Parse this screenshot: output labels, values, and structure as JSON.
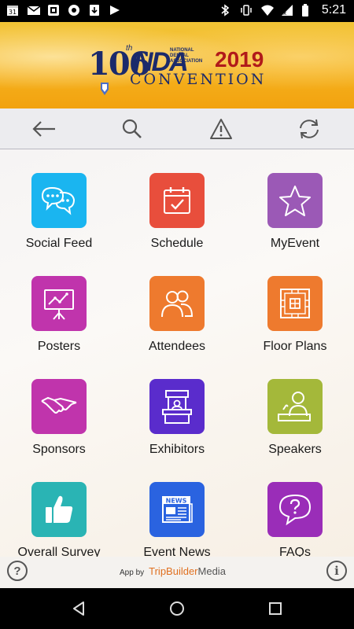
{
  "status_bar": {
    "time": "5:21",
    "calendar_day": "31",
    "left_icons": [
      "calendar-icon",
      "mail-icon",
      "app-icon",
      "circle-icon",
      "download-icon",
      "play-store-icon"
    ],
    "right_icons": [
      "bluetooth-icon",
      "vibrate-icon",
      "wifi-icon",
      "signal-icon",
      "battery-icon"
    ]
  },
  "banner": {
    "number": "106",
    "ordinal": "th",
    "org_abbrev": "NDA",
    "org_name": "NATIONAL DENTAL ASSOCIATION",
    "year": "2019",
    "event": "CONVENTION"
  },
  "toolbar": {
    "buttons": [
      "back-arrow-icon",
      "search-icon",
      "alert-icon",
      "sync-icon"
    ]
  },
  "grid": {
    "tiles": [
      {
        "label": "Social Feed",
        "icon": "chat-bubbles-icon",
        "color": "#1ab5f0"
      },
      {
        "label": "Schedule",
        "icon": "calendar-check-icon",
        "color": "#e84e3c"
      },
      {
        "label": "MyEvent",
        "icon": "star-icon",
        "color": "#9b59b6"
      },
      {
        "label": "Posters",
        "icon": "presentation-board-icon",
        "color": "#c034ac"
      },
      {
        "label": "Attendees",
        "icon": "people-icon",
        "color": "#ee7a2e"
      },
      {
        "label": "Floor Plans",
        "icon": "floor-plan-icon",
        "color": "#ee7a2e"
      },
      {
        "label": "Sponsors",
        "icon": "handshake-icon",
        "color": "#c034ac"
      },
      {
        "label": "Exhibitors",
        "icon": "booth-icon",
        "color": "#5a2ccc"
      },
      {
        "label": "Speakers",
        "icon": "speaker-podium-icon",
        "color": "#a4b83a"
      },
      {
        "label": "Overall Survey",
        "icon": "thumbs-up-icon",
        "color": "#2ab4b4"
      },
      {
        "label": "Event News",
        "icon": "newspaper-icon",
        "color": "#2a63e0"
      },
      {
        "label": "FAQs",
        "icon": "question-bubble-icon",
        "color": "#9a2db8"
      }
    ]
  },
  "footer": {
    "help": "?",
    "app_by": "App by",
    "brand_part1": "TripBuilder",
    "brand_part2": "Media",
    "info": "i"
  },
  "nav_bar": {
    "buttons": [
      "back-triangle-icon",
      "home-circle-icon",
      "recents-square-icon"
    ]
  }
}
